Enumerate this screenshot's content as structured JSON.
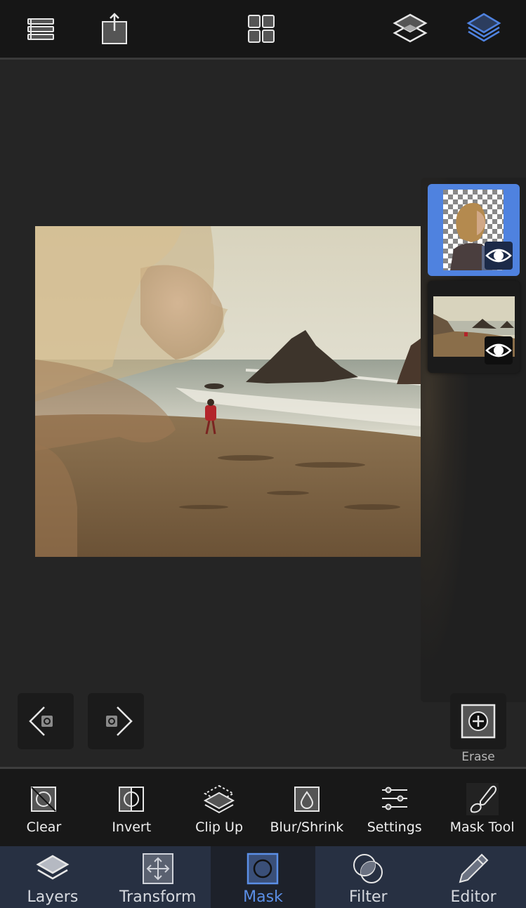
{
  "topbar": {
    "buttons": [
      {
        "id": "menu",
        "icon": "list-menu-icon"
      },
      {
        "id": "share",
        "icon": "share-export-icon"
      },
      {
        "id": "gallery",
        "icon": "grid-gallery-icon"
      },
      {
        "id": "blend",
        "icon": "layer-blend-icon"
      },
      {
        "id": "layers",
        "icon": "layers-stack-icon",
        "active": true
      }
    ]
  },
  "canvas": {
    "description": "Double-exposure composite of a child's profile over a beach scene"
  },
  "layers_panel": {
    "layers": [
      {
        "name": "Girl portrait (masked)",
        "selected": true,
        "visible": true
      },
      {
        "name": "Beach background",
        "selected": false,
        "visible": true
      }
    ]
  },
  "history": {
    "undo_icon": "undo-icon",
    "redo_icon": "redo-icon"
  },
  "erase": {
    "label": "Erase",
    "icon": "plus-circle-icon"
  },
  "mask_toolbar": {
    "tools": [
      {
        "label": "Clear",
        "icon": "clear-mask-icon"
      },
      {
        "label": "Invert",
        "icon": "invert-mask-icon"
      },
      {
        "label": "Clip Up",
        "icon": "clip-up-icon"
      },
      {
        "label": "Blur/Shrink",
        "icon": "blur-drop-icon"
      },
      {
        "label": "Settings",
        "icon": "sliders-icon"
      },
      {
        "label": "Mask Tool",
        "icon": "brush-icon"
      }
    ]
  },
  "tabbar": {
    "active": "Mask",
    "tabs": [
      {
        "label": "Layers",
        "icon": "layers-icon"
      },
      {
        "label": "Transform",
        "icon": "transform-icon"
      },
      {
        "label": "Mask",
        "icon": "mask-icon"
      },
      {
        "label": "Filter",
        "icon": "filter-icon"
      },
      {
        "label": "Editor",
        "icon": "pencil-icon"
      }
    ]
  },
  "colors": {
    "accent": "#4f82df",
    "active_tab_text": "#5b8fe6",
    "toolbar_bg": "#161616",
    "workspace_bg": "#252525",
    "tabbar_bg": "#273042"
  }
}
